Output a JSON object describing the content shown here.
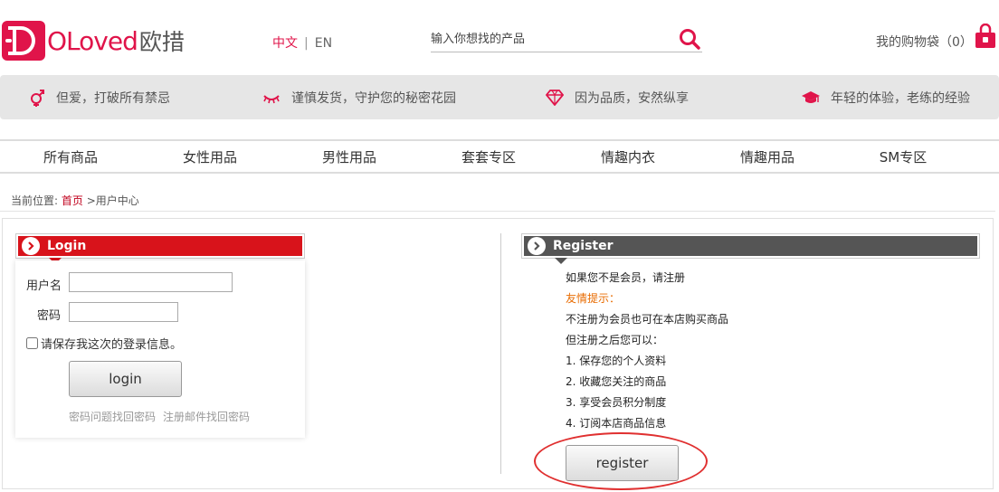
{
  "header": {
    "logo_text": "OLoved",
    "logo_cn": "欧措",
    "lang": {
      "active": "中文",
      "separator": "|",
      "other": "EN"
    },
    "search": {
      "placeholder": "输入你想找的产品"
    },
    "cart": {
      "label": "我的购物袋（0）"
    }
  },
  "slogans": [
    {
      "icon": "gender-icon",
      "text": "但爱，打破所有禁忌"
    },
    {
      "icon": "eyelash-icon",
      "text": "谨慎发货，守护您的秘密花园"
    },
    {
      "icon": "diamond-icon",
      "text": "因为品质，安然纵享"
    },
    {
      "icon": "graduation-cap-icon",
      "text": "年轻的体验，老练的经验"
    }
  ],
  "nav": [
    "所有商品",
    "女性用品",
    "男性用品",
    "套套专区",
    "情趣内衣",
    "情趣用品",
    "SM专区"
  ],
  "breadcrumb": {
    "prefix": "当前位置:",
    "home": "首页",
    "separator": ">",
    "current": "用户中心"
  },
  "login": {
    "title": "Login",
    "username_label": "用户名",
    "username_value": "",
    "password_label": "密码",
    "password_value": "",
    "remember_label": "请保存我这次的登录信息。",
    "button": "login",
    "link_question": "密码问题找回密码",
    "link_email": "注册邮件找回密码"
  },
  "register": {
    "title": "Register",
    "lines": [
      {
        "text": "如果您不是会员，请注册",
        "style": "normal"
      },
      {
        "text": "友情提示：",
        "style": "hint"
      },
      {
        "text": "不注册为会员也可在本店购买商品",
        "style": "normal"
      },
      {
        "text": "但注册之后您可以：",
        "style": "normal"
      },
      {
        "text": "1. 保存您的个人资料",
        "style": "normal"
      },
      {
        "text": "2. 收藏您关注的商品",
        "style": "normal"
      },
      {
        "text": "3. 享受会员积分制度",
        "style": "normal"
      },
      {
        "text": "4. 订阅本店商品信息",
        "style": "normal"
      }
    ],
    "button": "register"
  },
  "colors": {
    "brand": "#e0144a",
    "login_header": "#d8131b",
    "register_header": "#555555",
    "hint": "#e86b00",
    "annotation": "#e03030"
  }
}
